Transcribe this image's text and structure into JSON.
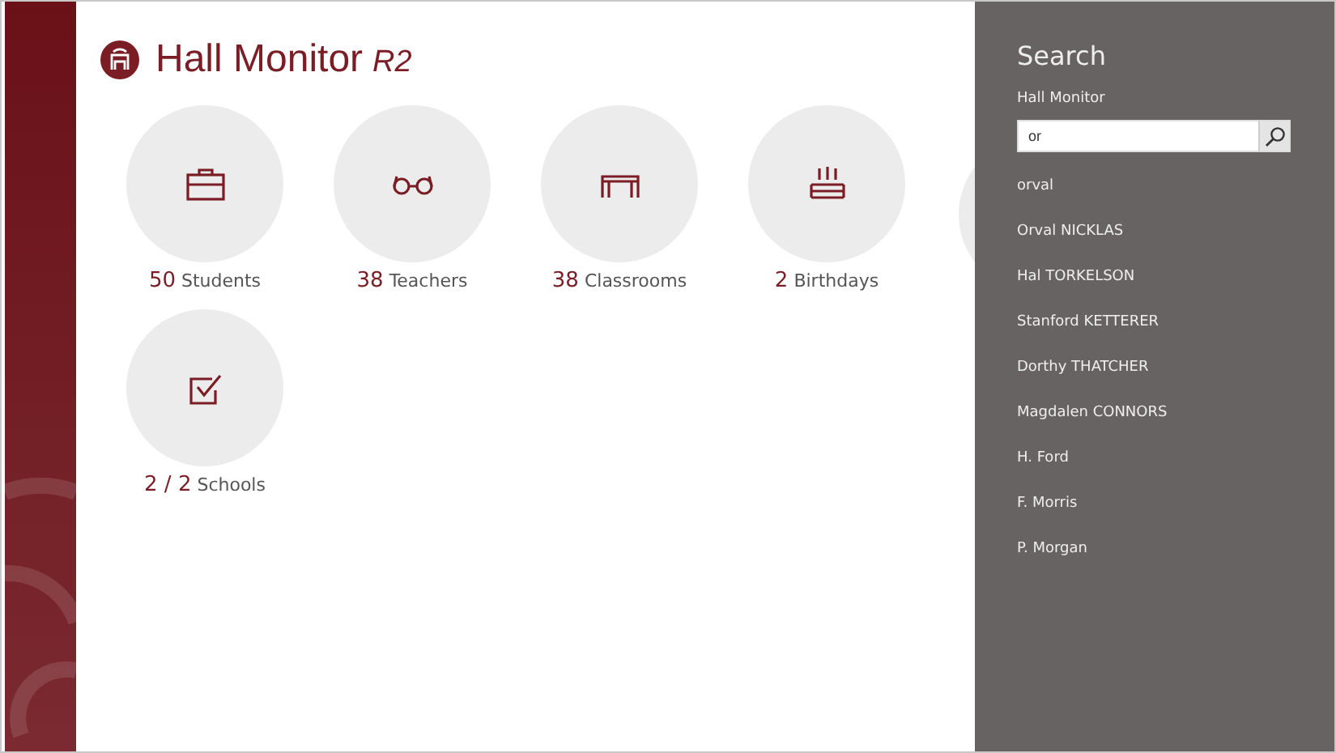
{
  "app": {
    "title": "Hall Monitor",
    "edition": "R2"
  },
  "tiles": [
    {
      "kind": "students",
      "count": "50",
      "label": "Students"
    },
    {
      "kind": "teachers",
      "count": "38",
      "label": "Teachers"
    },
    {
      "kind": "classrooms",
      "count": "38",
      "label": "Classrooms"
    },
    {
      "kind": "birthdays",
      "count": "2",
      "label": "Birthdays"
    },
    {
      "kind": "schools",
      "count": "2 / 2",
      "label": "Schools"
    }
  ],
  "search": {
    "title": "Search",
    "scope": "Hall Monitor",
    "value": "or",
    "suggestions": [
      "orval",
      "Orval NICKLAS",
      "Hal TORKELSON",
      "Stanford KETTERER",
      "Dorthy THATCHER",
      "Magdalen CONNORS",
      "H. Ford",
      "F. Morris",
      "P. Morgan"
    ]
  }
}
